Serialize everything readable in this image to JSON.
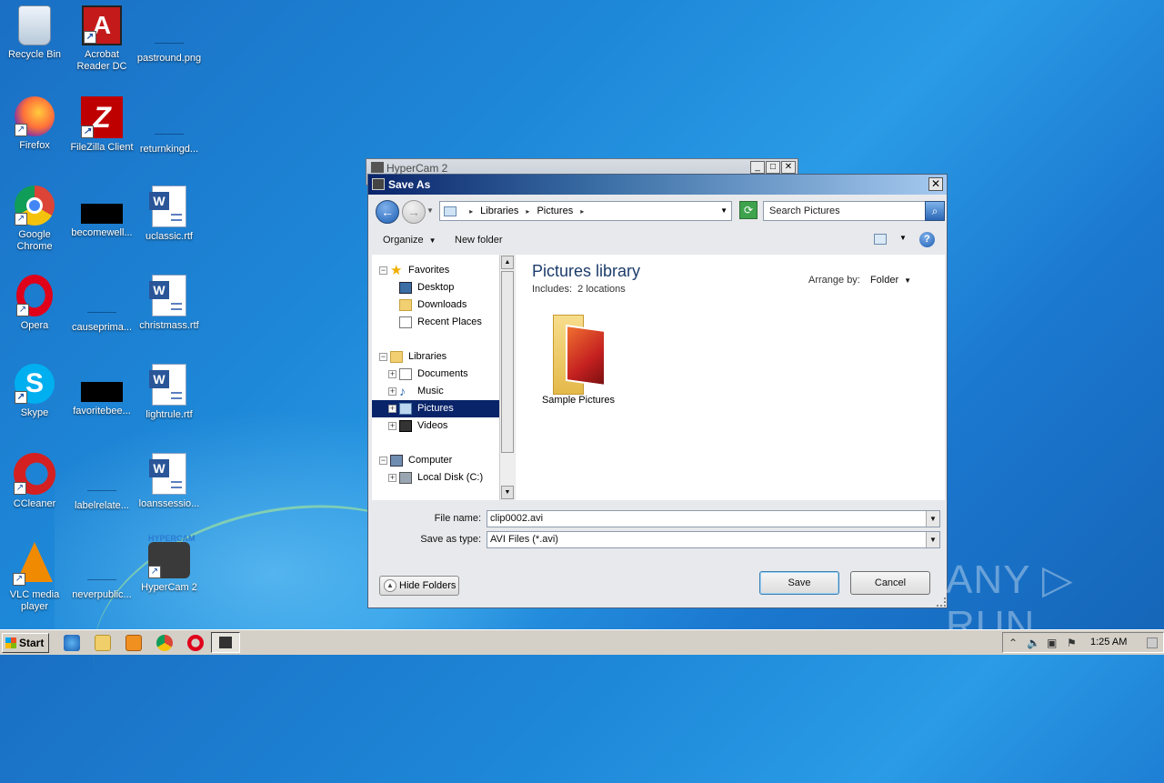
{
  "desktop": {
    "icons": {
      "recycle_bin": "Recycle Bin",
      "acrobat": "Acrobat Reader DC",
      "pastround": "pastround.png",
      "firefox": "Firefox",
      "filezilla": "FileZilla Client",
      "returnkingd": "returnkingd...",
      "chrome": "Google Chrome",
      "becomewell": "becomewell...",
      "uclassic": "uclassic.rtf",
      "opera": "Opera",
      "causeprima": "causeprima...",
      "christmass": "christmass.rtf",
      "skype": "Skype",
      "favoritebee": "favoritebee...",
      "lightrule": "lightrule.rtf",
      "ccleaner": "CCleaner",
      "labelrelate": "labelrelate...",
      "loanssessio": "loanssessio...",
      "vlc": "VLC media player",
      "neverpublic": "neverpublic...",
      "hypercam": "HyperCam 2"
    },
    "hypercam_badge": "HYPERCAM",
    "watermark": "ANY ▷ RUN"
  },
  "hypercam_window": {
    "title": "HyperCam 2"
  },
  "dialog": {
    "title": "Save As",
    "close_glyph": "✕",
    "address": {
      "crumbs": [
        "Libraries",
        "Pictures"
      ]
    },
    "search_placeholder": "Search Pictures",
    "toolbar": {
      "organize": "Organize",
      "new_folder": "New folder",
      "help": "?"
    },
    "tree": {
      "favorites": "Favorites",
      "desktop": "Desktop",
      "downloads": "Downloads",
      "recent_places": "Recent Places",
      "libraries": "Libraries",
      "documents": "Documents",
      "music": "Music",
      "pictures": "Pictures",
      "videos": "Videos",
      "computer": "Computer",
      "local_disk": "Local Disk (C:)"
    },
    "content": {
      "title": "Pictures library",
      "includes_label": "Includes:",
      "includes_link": "2 locations",
      "arrange_label": "Arrange by:",
      "arrange_value": "Folder",
      "items": [
        "Sample Pictures"
      ]
    },
    "file_name_label": "File name:",
    "file_name_value": "clip0002.avi",
    "save_type_label": "Save as type:",
    "save_type_value": "AVI Files (*.avi)",
    "hide_folders": "Hide Folders",
    "save_button": "Save",
    "cancel_button": "Cancel"
  },
  "taskbar": {
    "start": "Start",
    "clock": "1:25 AM"
  }
}
